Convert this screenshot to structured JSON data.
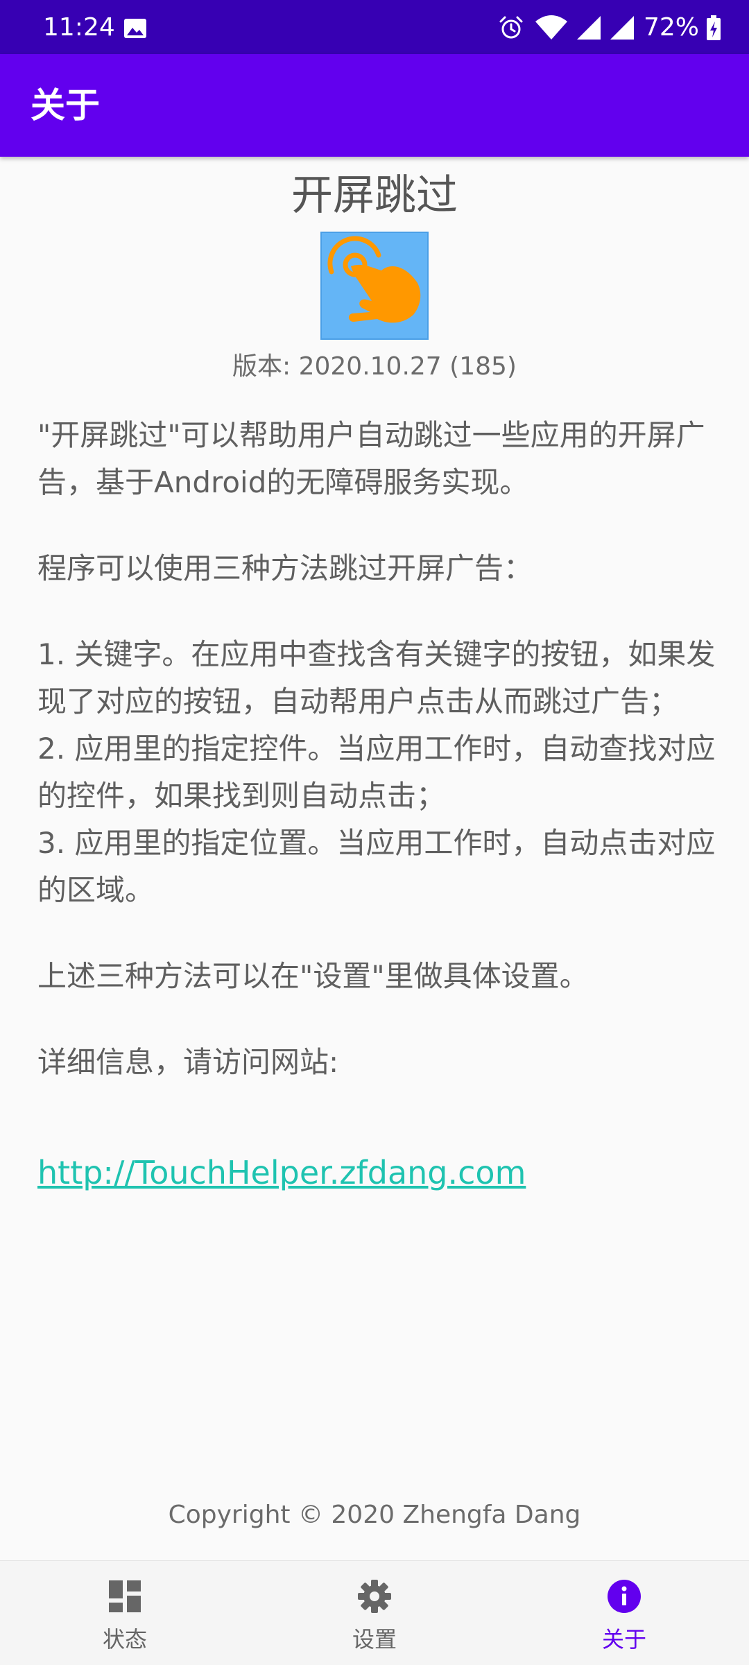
{
  "status_bar": {
    "time": "11:24",
    "battery": "72%",
    "icons": [
      "image-icon",
      "alarm-icon",
      "wifi-icon",
      "signal-icon",
      "signal-icon",
      "battery-charging-icon"
    ]
  },
  "app_bar": {
    "title": "关于",
    "color": "#6200ee"
  },
  "app_info": {
    "name": "开屏跳过",
    "version_label": "版本: 2020.10.27 (185)",
    "logo_icon": "tap-hand-icon"
  },
  "description": {
    "intro": "\"开屏跳过\"可以帮助用户自动跳过一些应用的开屏广告，基于Android的无障碍服务实现。",
    "methods_heading": "程序可以使用三种方法跳过开屏广告：",
    "method_1": "1. 关键字。在应用中查找含有关键字的按钮，如果发现了对应的按钮，自动帮用户点击从而跳过广告；",
    "method_2": "2. 应用里的指定控件。当应用工作时，自动查找对应的控件，如果找到则自动点击；",
    "method_3": "3. 应用里的指定位置。当应用工作时，自动点击对应的区域。",
    "settings_note": "上述三种方法可以在\"设置\"里做具体设置。",
    "more_info": "详细信息，请访问网站:",
    "website": "http://TouchHelper.zfdang.com"
  },
  "copyright": "Copyright © 2020 Zhengfa Dang",
  "bottom_nav": {
    "items": [
      {
        "label": "状态",
        "icon": "dashboard-icon"
      },
      {
        "label": "设置",
        "icon": "gear-icon"
      },
      {
        "label": "关于",
        "icon": "info-icon",
        "active": true
      }
    ],
    "active_color": "#6200ee"
  }
}
